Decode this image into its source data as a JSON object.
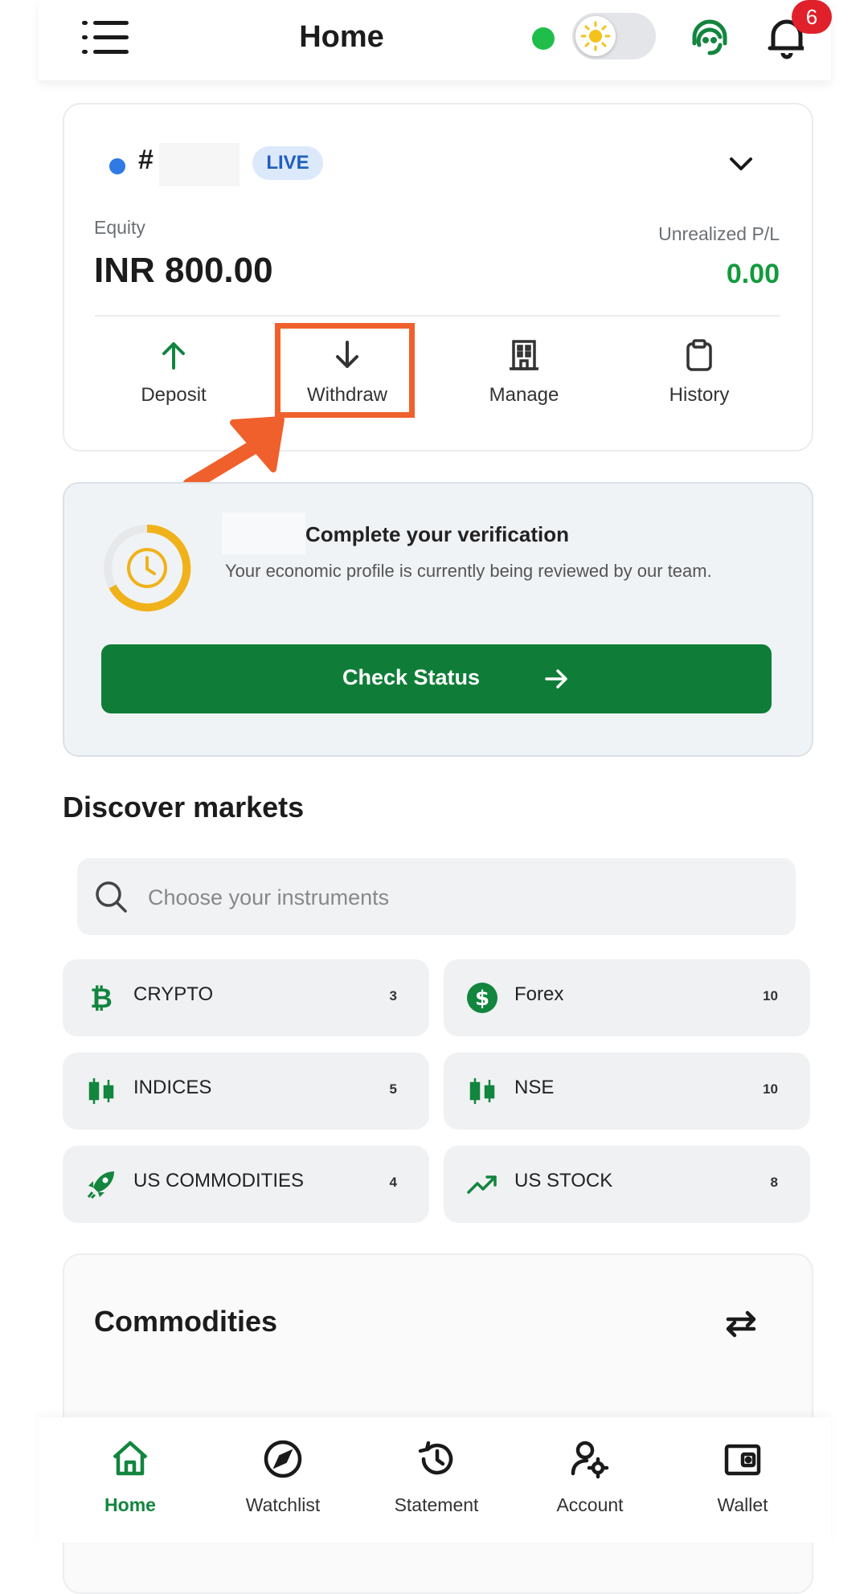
{
  "header": {
    "title": "Home",
    "notification_count": "6",
    "icons": [
      "menu-icon",
      "online-status-dot",
      "theme-toggle",
      "support-agent-icon",
      "bell-icon"
    ]
  },
  "account": {
    "hash_prefix": "#",
    "badge": "LIVE",
    "equity_label": "Equity",
    "equity_value": "INR 800.00",
    "upl_label": "Unrealized P/L",
    "upl_value": "0.00",
    "actions": [
      {
        "label": "Deposit",
        "icon": "arrow-up-icon"
      },
      {
        "label": "Withdraw",
        "icon": "arrow-down-icon"
      },
      {
        "label": "Manage",
        "icon": "building-icon"
      },
      {
        "label": "History",
        "icon": "clipboard-icon"
      }
    ]
  },
  "verification": {
    "title": "Complete your verification",
    "subtitle": "Your economic profile is currently being reviewed by our team.",
    "button": "Check Status"
  },
  "discover": {
    "title": "Discover markets",
    "search_placeholder": "Choose your instruments",
    "markets": [
      {
        "name": "CRYPTO",
        "count": "3",
        "icon": "bitcoin-icon"
      },
      {
        "name": "Forex",
        "count": "10",
        "icon": "dollar-coin-icon"
      },
      {
        "name": "INDICES",
        "count": "5",
        "icon": "candlestick-icon"
      },
      {
        "name": "NSE",
        "count": "10",
        "icon": "candlestick-icon"
      },
      {
        "name": "US COMMODITIES",
        "count": "4",
        "icon": "rocket-icon"
      },
      {
        "name": "US STOCK",
        "count": "8",
        "icon": "trend-up-icon"
      }
    ]
  },
  "commodities": {
    "title": "Commodities"
  },
  "bottom_nav": [
    {
      "label": "Home",
      "icon": "home-icon",
      "active": true
    },
    {
      "label": "Watchlist",
      "icon": "compass-icon"
    },
    {
      "label": "Statement",
      "icon": "history-icon"
    },
    {
      "label": "Account",
      "icon": "user-settings-icon"
    },
    {
      "label": "Wallet",
      "icon": "wallet-icon"
    }
  ],
  "colors": {
    "brand_green": "#0f7d37",
    "profit_green": "#129a3c",
    "live_blue": "#2f7ae5",
    "badge_red": "#e0212c",
    "highlight_orange": "#f0602c",
    "timer_yellow": "#f0b21b"
  }
}
